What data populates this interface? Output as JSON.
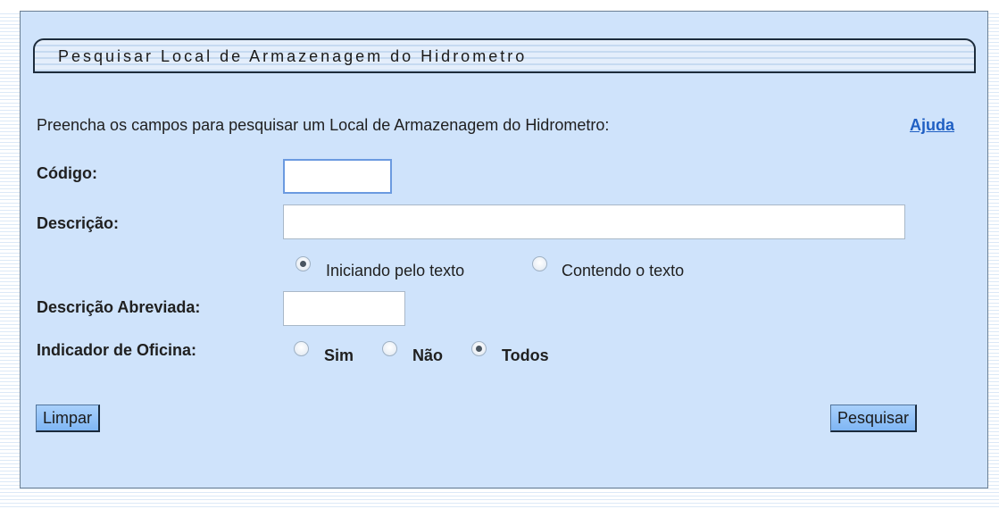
{
  "title": "Pesquisar Local de Armazenagem do Hidrometro",
  "instruction": "Preencha os campos para pesquisar um Local de Armazenagem do Hidrometro:",
  "help_link": "Ajuda",
  "fields": {
    "codigo": {
      "label": "Código:",
      "value": ""
    },
    "descricao": {
      "label": "Descrição:",
      "value": ""
    },
    "descricao_abreviada": {
      "label": "Descrição Abreviada:",
      "value": ""
    },
    "indicador_oficina": {
      "label": "Indicador de Oficina:"
    }
  },
  "match_mode": {
    "options": [
      "Iniciando pelo texto",
      "Contendo o texto"
    ],
    "selected": "Iniciando pelo texto"
  },
  "oficina_options": {
    "options": [
      "Sim",
      "Não",
      "Todos"
    ],
    "selected": "Todos"
  },
  "buttons": {
    "clear": "Limpar",
    "search": "Pesquisar"
  }
}
